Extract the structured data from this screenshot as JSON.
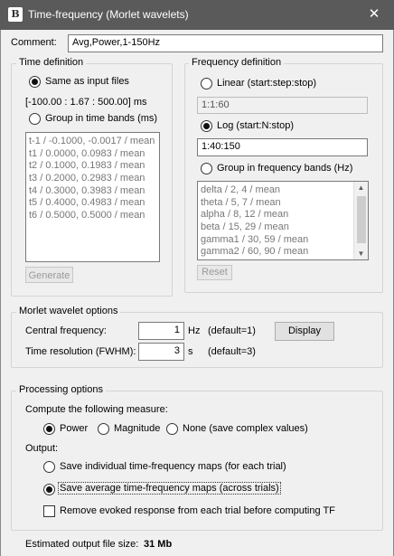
{
  "window": {
    "title": "Time-frequency (Morlet wavelets)",
    "app_icon": "B"
  },
  "comment": {
    "label": "Comment:",
    "value": "Avg,Power,1-150Hz"
  },
  "time_definition": {
    "title": "Time definition",
    "same_as_input_label": "Same as input files",
    "same_as_input_selected": true,
    "range_text": "[-100.00 : 1.67 : 500.00] ms",
    "group_label": "Group in time bands (ms)",
    "group_selected": false,
    "bands": [
      "t-1 / -0.1000, -0.0017 / mean",
      "t1 / 0.0000, 0.0983 / mean",
      "t2 / 0.1000, 0.1983 / mean",
      "t3 / 0.2000, 0.2983 / mean",
      "t4 / 0.3000, 0.3983 / mean",
      "t5 / 0.4000, 0.4983 / mean",
      "t6 / 0.5000, 0.5000 / mean"
    ],
    "generate_label": "Generate"
  },
  "frequency_definition": {
    "title": "Frequency definition",
    "linear_label": "Linear (start:step:stop)",
    "linear_selected": false,
    "linear_value": "1:1:60",
    "log_label": "Log (start:N:stop)",
    "log_selected": true,
    "log_value": "1:40:150",
    "group_label": "Group in frequency bands (Hz)",
    "group_selected": false,
    "bands": [
      "delta / 2, 4 / mean",
      "theta / 5, 7 / mean",
      "alpha / 8, 12 / mean",
      "beta / 15, 29 / mean",
      "gamma1 / 30, 59 / mean",
      "gamma2 / 60, 90 / mean"
    ],
    "reset_label": "Reset"
  },
  "morlet": {
    "title": "Morlet wavelet options",
    "central_label": "Central frequency:",
    "central_value": "1",
    "central_unit": "Hz",
    "central_default": "(default=1)",
    "display_label": "Display",
    "resolution_label": "Time resolution (FWHM):",
    "resolution_value": "3",
    "resolution_unit": "s",
    "resolution_default": "(default=3)"
  },
  "processing": {
    "title": "Processing options",
    "measure_label": "Compute the following measure:",
    "measures": [
      {
        "label": "Power",
        "selected": true
      },
      {
        "label": "Magnitude",
        "selected": false
      },
      {
        "label": "None (save complex values)",
        "selected": false
      }
    ],
    "output_label": "Output:",
    "output_individual_label": "Save individual time-frequency maps (for each trial)",
    "output_individual_selected": false,
    "output_average_label": "Save average time-frequency maps (across trials)",
    "output_average_selected": true,
    "remove_evoked_label": "Remove evoked response from each trial before computing TF",
    "remove_evoked_checked": false
  },
  "footer": {
    "size_label": "Estimated output file size:",
    "size_value": "31 Mb"
  },
  "icons": {
    "close": "close-icon",
    "scroll_up": "chevron-up-icon",
    "scroll_down": "chevron-down-icon"
  }
}
